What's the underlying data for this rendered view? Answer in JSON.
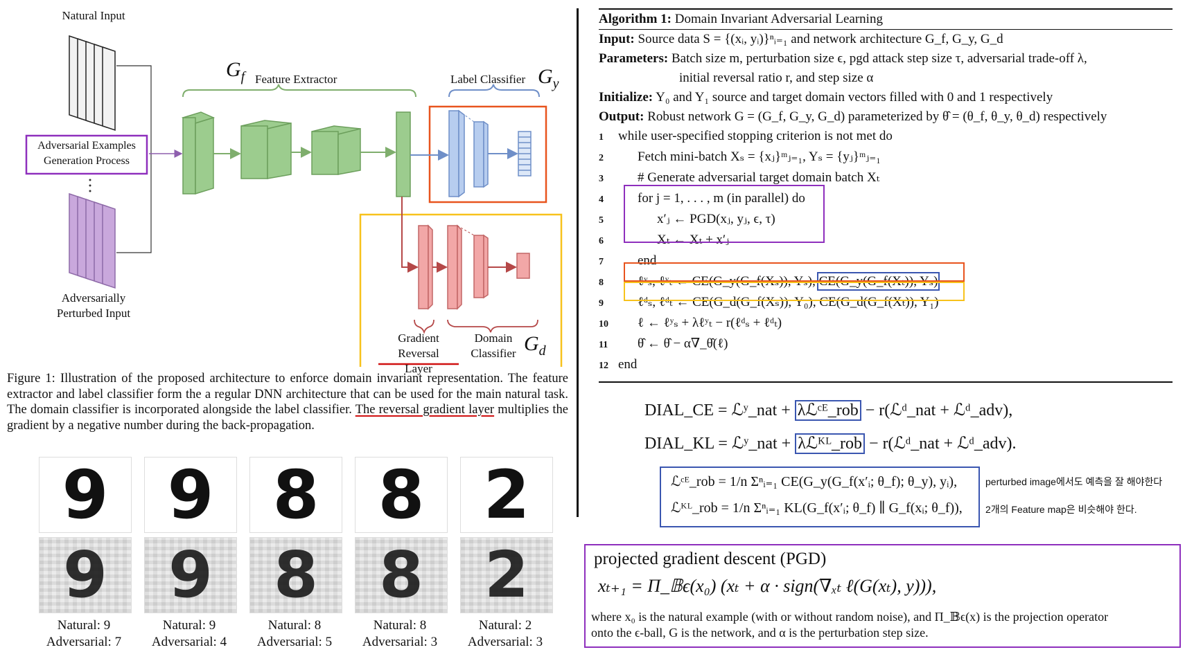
{
  "figure": {
    "natural_input": "Natural Input",
    "adv_gen_line1": "Adversarial Examples",
    "adv_gen_line2": "Generation Process",
    "adv_input_line1": "Adversarially",
    "adv_input_line2": "Perturbed Input",
    "gf_symbol": "G",
    "gf_sub": "f",
    "gf_label": "Feature Extractor",
    "gy_label": "Label Classifier",
    "gy_symbol": "G",
    "gy_sub": "y",
    "gd_symbol": "G",
    "gd_sub": "d",
    "grl_line1": "Gradient",
    "grl_line2": "Reversal Layer",
    "dc_line1": "Domain",
    "dc_line2": "Classifier",
    "colors": {
      "green": "#9ccc8e",
      "blue": "#b7cdef",
      "red": "#f2a7a7",
      "purple": "#c9a8dc",
      "orange": "#e8541e",
      "yellow": "#f7c21c",
      "purple_box": "#8e2fbd"
    }
  },
  "caption": {
    "part1": "Figure 1: Illustration of the proposed architecture to enforce domain invariant representation. The feature extractor and label classifier form the a regular DNN architecture that can be used for the main natural task. The domain classifier is incorporated alongside the label classifier. ",
    "underlined": "The reversal gradient layer",
    "part2": " multiplies the gradient by a negative number during the back-propagation."
  },
  "mnist": [
    {
      "natural_digit": "9",
      "adv_digit": "9",
      "natural_label": "Natural: 9",
      "adv_label": "Adversarial: 7"
    },
    {
      "natural_digit": "9",
      "adv_digit": "9",
      "natural_label": "Natural: 9",
      "adv_label": "Adversarial: 4"
    },
    {
      "natural_digit": "8",
      "adv_digit": "8",
      "natural_label": "Natural: 8",
      "adv_label": "Adversarial: 5"
    },
    {
      "natural_digit": "8",
      "adv_digit": "8",
      "natural_label": "Natural: 8",
      "adv_label": "Adversarial: 3"
    },
    {
      "natural_digit": "2",
      "adv_digit": "2",
      "natural_label": "Natural: 2",
      "adv_label": "Adversarial: 3"
    }
  ],
  "algorithm": {
    "title_bold": "Algorithm 1:",
    "title_rest": " Domain Invariant Adversarial Learning",
    "input_label": "Input:",
    "input_text": " Source data S = {(xᵢ, yᵢ)}ⁿᵢ₌₁ and network architecture G_f, G_y, G_d",
    "params_label": "Parameters:",
    "params_text1": " Batch size m, perturbation size ϵ, pgd attack step size τ, adversarial trade-off λ,",
    "params_text2": "initial reversal ratio r, and step size α",
    "init_label": "Initialize:",
    "init_text": " Y₀ and Y₁ source and target domain vectors filled with 0 and 1 respectively",
    "output_label": "Output:",
    "output_text": " Robust network G = (G_f, G_y, G_d) parameterized by θ̂ = (θ_f, θ_y, θ_d) respectively",
    "lines": [
      {
        "n": "1",
        "text": "while user-specified stopping criterion is not met do"
      },
      {
        "n": "2",
        "text": "Fetch mini-batch Xₛ = {xⱼ}ᵐⱼ₌₁, Yₛ = {yⱼ}ᵐⱼ₌₁"
      },
      {
        "n": "3",
        "text": "# Generate adversarial target domain batch Xₜ"
      },
      {
        "n": "4",
        "text": "for j = 1, . . . , m (in parallel) do"
      },
      {
        "n": "5",
        "text": "x′ⱼ ← PGD(xⱼ, yⱼ, ϵ, τ)"
      },
      {
        "n": "6",
        "text": "Xₜ ← Xₜ + x′ⱼ"
      },
      {
        "n": "7",
        "text": "end"
      },
      {
        "n": "8",
        "text_a": "ℓʸₛ, ℓʸₜ ← CE(G_y(G_f(Xₛ)), Yₛ), ",
        "text_b": "CE(G_y(G_f(Xₜ)), Yₛ)"
      },
      {
        "n": "9",
        "text": "ℓᵈₛ, ℓᵈₜ ← CE(G_d(G_f(Xₛ)), Y₀), CE(G_d(G_f(Xₜ)), Y₁)"
      },
      {
        "n": "10",
        "text": "ℓ ← ℓʸₛ + λℓʸₜ − r(ℓᵈₛ + ℓᵈₜ)"
      },
      {
        "n": "11",
        "text": "θ̂ ← θ̂ − α∇_θ̂(ℓ)"
      },
      {
        "n": "12",
        "text": "end"
      }
    ]
  },
  "formulas": {
    "dial_ce_a": "DIAL_CE = ℒʸ_nat + ",
    "dial_ce_box": "λℒᶜᴱ_rob",
    "dial_ce_b": " − r(ℒᵈ_nat + ℒᵈ_adv),",
    "dial_kl_a": "DIAL_KL = ℒʸ_nat + ",
    "dial_kl_box": "λℒᴷᴸ_rob",
    "dial_kl_b": " − r(ℒᵈ_nat + ℒᵈ_adv).",
    "rob_ce": "ℒᶜᴱ_rob = 1/n Σⁿᵢ₌₁ CE(G_y(G_f(x′ᵢ; θ_f); θ_y), yᵢ),",
    "rob_kl": "ℒᴷᴸ_rob = 1/n Σⁿᵢ₌₁ KL(G_f(x′ᵢ; θ_f) ∥ G_f(xᵢ; θ_f)),",
    "note_ce": "perturbed image에서도 예측을 잘 해야한다",
    "note_kl": "2개의 Feature map은 비슷해야 한다."
  },
  "pgd": {
    "title": "projected gradient descent (PGD)",
    "equation": "xₜ₊₁ = Π_𝔹ϵ(x₀) (xₜ + α · sign(∇ₓₜ ℓ(G(xₜ), y))),",
    "desc1": "where x₀ is the natural example (with or without random noise), and Π_𝔹ϵ(x) is the projection operator",
    "desc2": "onto the ϵ-ball, G is the network, and α is the perturbation step size."
  }
}
